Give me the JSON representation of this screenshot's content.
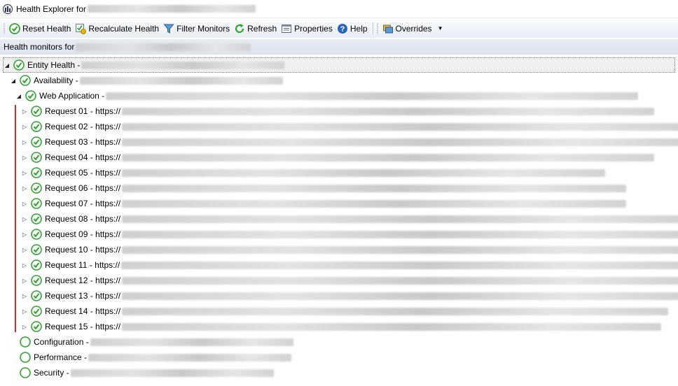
{
  "window": {
    "title": "Health Explorer for"
  },
  "toolbar": {
    "reset_health": "Reset Health",
    "recalculate_health": "Recalculate Health",
    "filter_monitors": "Filter Monitors",
    "refresh": "Refresh",
    "properties": "Properties",
    "help": "Help",
    "overrides": "Overrides"
  },
  "subheader": {
    "label": "Health monitors for"
  },
  "tree": {
    "entity_health": "Entity Health -",
    "availability": "Availability -",
    "web_application": "Web Application -",
    "requests": [
      "Request 01 - https://",
      "Request 02 - https://",
      "Request 03 - https://",
      "Request 04 - https://",
      "Request 05 - https://",
      "Request 06 - https://",
      "Request 07 - https://",
      "Request 08 - https://",
      "Request 09 - https://",
      "Request 10 - https://",
      "Request 11 - https://",
      "Request 12 - https://",
      "Request 13 - https://",
      "Request 14 - https://",
      "Request 15 - https://"
    ],
    "configuration": "Configuration -",
    "performance": "Performance -",
    "security": "Security -"
  },
  "colors": {
    "healthy_green": "#2fa52f",
    "accent_blue": "#2a64b8",
    "selection_border": "#777777",
    "red_marker": "#d42a2a"
  },
  "icons": {
    "healthy": "check-circle-icon",
    "not_monitored": "empty-circle-icon"
  }
}
